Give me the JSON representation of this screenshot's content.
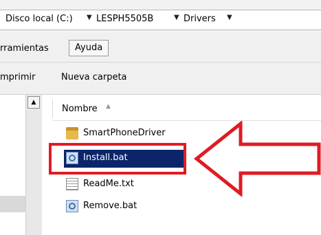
{
  "address": {
    "crumbs": [
      "Disco local (C:)",
      "LESPH5505B",
      "Drivers"
    ]
  },
  "menu": {
    "herramientas": "rramientas",
    "ayuda": "Ayuda"
  },
  "toolbar": {
    "imprimir": "mprimir",
    "nueva_carpeta": "Nueva carpeta"
  },
  "columns": {
    "name": "Nombre"
  },
  "files": [
    {
      "name": "SmartPhoneDriver",
      "icon": "folder-icon",
      "selected": false
    },
    {
      "name": "Install.bat",
      "icon": "batch-file-icon",
      "selected": true
    },
    {
      "name": "ReadMe.txt",
      "icon": "text-file-icon",
      "selected": false
    },
    {
      "name": "Remove.bat",
      "icon": "batch-file-icon",
      "selected": false
    }
  ],
  "colors": {
    "selection": "#0b246a",
    "annotation": "#e01b24"
  }
}
